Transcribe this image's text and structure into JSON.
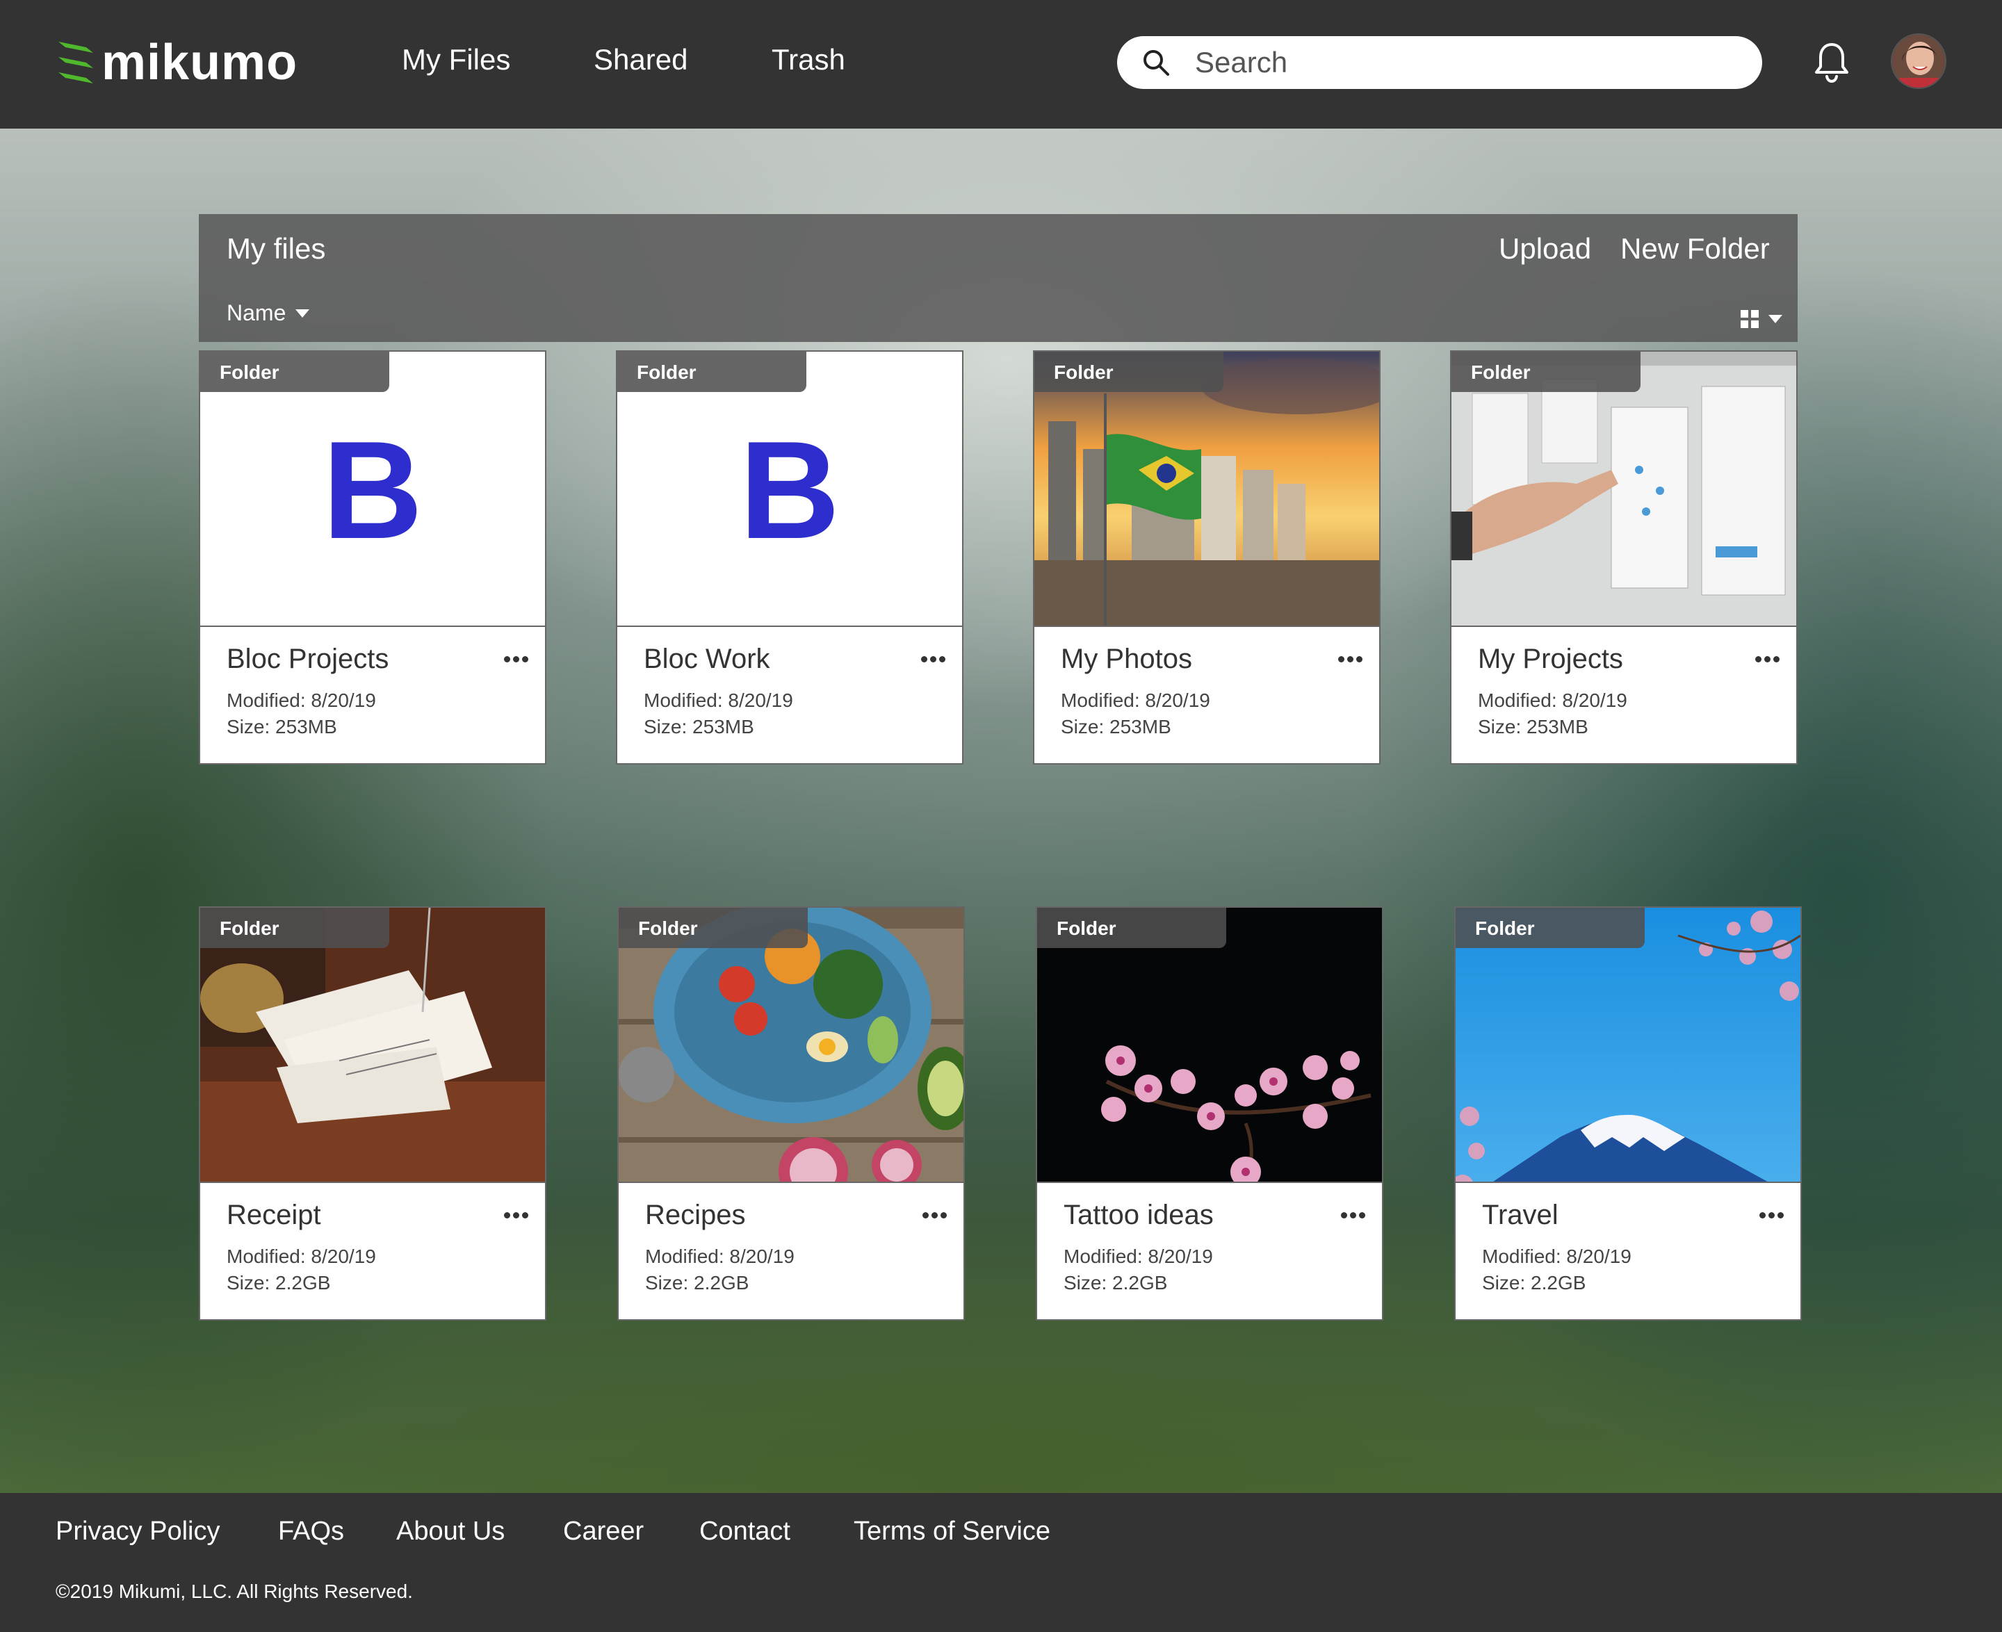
{
  "header": {
    "logo_text": "mikumo",
    "nav": [
      "My Files",
      "Shared",
      "Trash"
    ],
    "search": {
      "placeholder": "Search"
    },
    "icons": {
      "search": "search-icon",
      "bell": "bell-icon",
      "avatar": "avatar"
    },
    "brand_color": "#4fb82c"
  },
  "toolbar": {
    "title": "My files",
    "upload_label": "Upload",
    "new_folder_label": "New Folder",
    "sort_label": "Name",
    "view_icon": "grid-view-icon"
  },
  "cards": [
    {
      "tag": "Folder",
      "name": "Bloc Projects",
      "modified": "Modified: 8/20/19",
      "size": "Size: 253MB",
      "thumb": "letter-b"
    },
    {
      "tag": "Folder",
      "name": "Bloc Work",
      "modified": "Modified: 8/20/19",
      "size": "Size: 253MB",
      "thumb": "letter-b"
    },
    {
      "tag": "Folder",
      "name": "My Photos",
      "modified": "Modified: 8/20/19",
      "size": "Size: 253MB",
      "thumb": "city-sunset-photo"
    },
    {
      "tag": "Folder",
      "name": "My Projects",
      "modified": "Modified: 8/20/19",
      "size": "Size: 253MB",
      "thumb": "whiteboard-photo"
    },
    {
      "tag": "Folder",
      "name": "Receipt",
      "modified": "Modified: 8/20/19",
      "size": "Size: 2.2GB",
      "thumb": "receipts-photo"
    },
    {
      "tag": "Folder",
      "name": "Recipes",
      "modified": "Modified: 8/20/19",
      "size": "Size: 2.2GB",
      "thumb": "salad-bowl-photo"
    },
    {
      "tag": "Folder",
      "name": "Tattoo ideas",
      "modified": "Modified: 8/20/19",
      "size": "Size: 2.2GB",
      "thumb": "cherry-blossom-photo"
    },
    {
      "tag": "Folder",
      "name": "Travel",
      "modified": "Modified: 8/20/19",
      "size": "Size: 2.2GB",
      "thumb": "mount-fuji-photo"
    }
  ],
  "letter_b": "B",
  "footer": {
    "links": [
      "Privacy Policy",
      "FAQs",
      "About Us",
      "Career",
      "Contact",
      "Terms of Service"
    ],
    "copyright": "©2019 Mikumi, LLC. All Rights Reserved."
  }
}
